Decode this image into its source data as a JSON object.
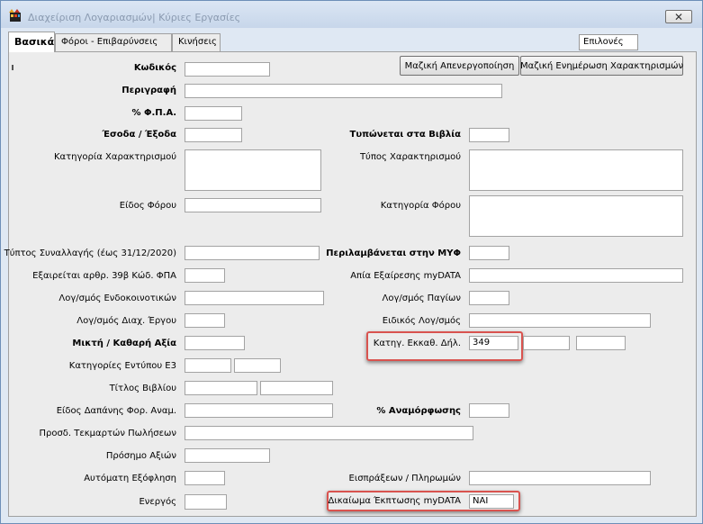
{
  "window": {
    "title": "Διαχείριση Λογαριασμών| Κύριες Εργασίες",
    "close_glyph": "✕"
  },
  "tabs": [
    {
      "label": "Βασικά"
    },
    {
      "label": "Φόροι - Επιβαρύνσεις"
    },
    {
      "label": "Κινήσεις"
    }
  ],
  "options_label": "Επιλονές",
  "buttons": {
    "mass_deactivation": "Μαζική Απενεργοποίηση",
    "mass_update_characterizations": "Μαζική Ενημέρωση Χαρακτηρισμών"
  },
  "left_fields": {
    "code": {
      "label": "Κωδικός",
      "value": ""
    },
    "description": {
      "label": "Περιγραφή",
      "value": ""
    },
    "vat": {
      "label": "% Φ.Π.Α.",
      "value": ""
    },
    "income_expense": {
      "label": "Έσοδα / Έξοδα",
      "value": ""
    },
    "characterization_category": {
      "label": "Κατηγορία Χαρακτηρισμού",
      "value": ""
    },
    "tax_kind": {
      "label": "Είδος Φόρου",
      "value": ""
    },
    "transaction_type": {
      "label": "Τύπτος Συναλλαγής (έως 31/12/2020)",
      "value": ""
    },
    "exempt_39b": {
      "label": "Εξαιρείται αρθρ. 39β Κώδ. ΦΠΑ",
      "value": ""
    },
    "intra_community": {
      "label": "Λογ/σμός Ενδοκοινοτικών",
      "value": ""
    },
    "project_management": {
      "label": "Λογ/σμός Διαχ. Έργου",
      "value": ""
    },
    "gross_net": {
      "label": "Μικτή  / Καθαρή Αξία",
      "value": ""
    },
    "e3_categories": {
      "label": "Κατηγορίες Εντύπου Ε3",
      "value1": "",
      "value2": ""
    },
    "book_title": {
      "label": "Τίτλος Βιβλίου",
      "value1": "",
      "value2": ""
    },
    "expense_kind": {
      "label": "Είδος Δαπάνης Φορ. Αναμ.",
      "value": ""
    },
    "sales_presumptions": {
      "label": "Προσδ. Τεκμαρτών Πωλήσεων",
      "value": ""
    },
    "value_sign": {
      "label": "Πρόσημο Αξιών",
      "value": ""
    },
    "auto_settlement": {
      "label": "Αυτόματη Εξόφληση",
      "value": ""
    },
    "active": {
      "label": "Ενεργός",
      "value": ""
    }
  },
  "right_fields": {
    "printed_in_books": {
      "label": "Τυπώνεται στα Βιβλία",
      "value": ""
    },
    "characterization_type": {
      "label": "Τύπος Χαρακτηρισμού",
      "value": ""
    },
    "tax_category": {
      "label": "Κατηγορία Φόρου",
      "value": ""
    },
    "included_in_myf": {
      "label": "Περιλαμβάνεται στην ΜΥΦ",
      "value": ""
    },
    "exemption_reason": {
      "label": "Απία Εξαίρεσης myDATA",
      "value": ""
    },
    "fixed_assets": {
      "label": "Λογ/σμός  Παγίων",
      "value": ""
    },
    "special_account": {
      "label": "Ειδικός Λογ/σμός",
      "value": ""
    },
    "tax_return_category": {
      "label": "Κατηγ. Εκκαθ. Δήλ.",
      "value": "349",
      "value2": "",
      "value3": ""
    },
    "revaluation": {
      "label": "% Αναμόρφωσης",
      "value": ""
    },
    "receipts_payments": {
      "label": "Εισπράξεων / Πληρωμών",
      "value": ""
    },
    "deduction_right": {
      "label": "Δικαίωμα Έκπτωσης myDATA",
      "value": "ΝΑΙ"
    }
  },
  "colors": {
    "highlight": "#d9534f",
    "panel": "#ececec",
    "titlebar": "#c7d6ea"
  }
}
